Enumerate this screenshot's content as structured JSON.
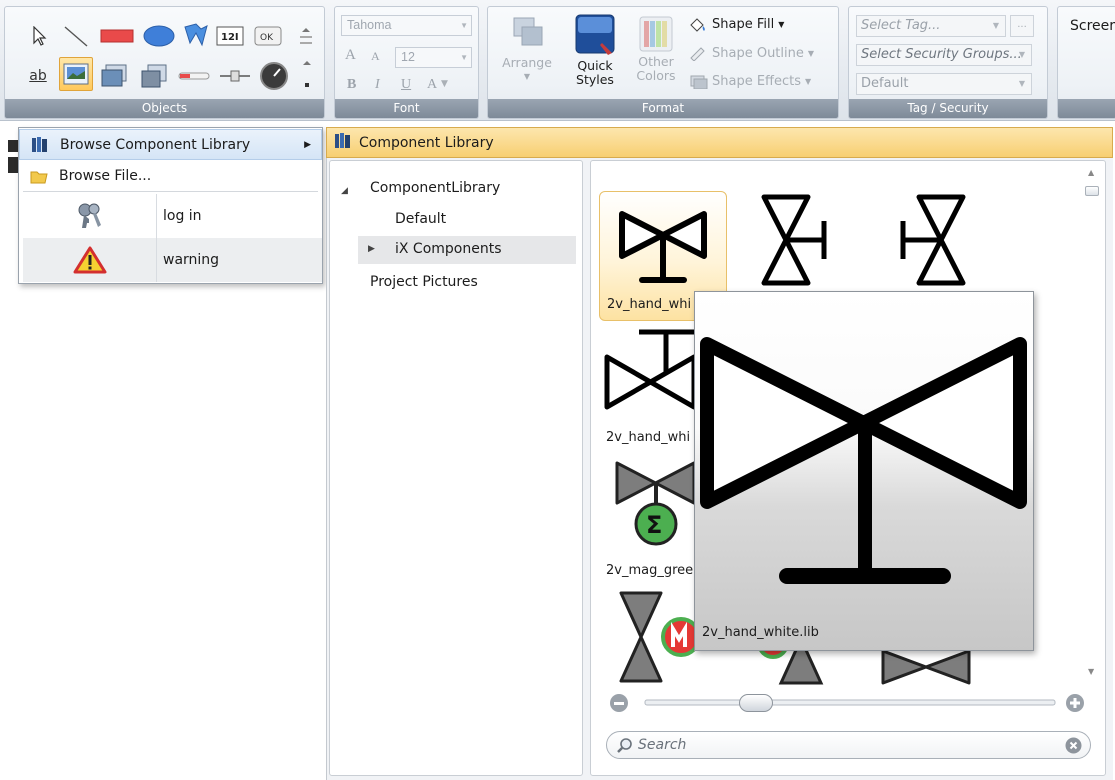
{
  "ribbon": {
    "groups": {
      "objects": "Objects",
      "font": "Font",
      "format": "Format",
      "tag_security": "Tag / Security"
    },
    "object_icons_row1": [
      "pointer-icon",
      "line-icon",
      "rectangle-icon",
      "ellipse-icon",
      "polyline-icon",
      "analog-numeric-icon",
      "button-ok-icon",
      "scroll-up-icon"
    ],
    "object_icons_row2": [
      "text-icon",
      "picture-icon",
      "multi-picture-icon",
      "animated-picture-icon",
      "linear-meter-icon",
      "slider-icon",
      "circular-meter-icon",
      "more-icon"
    ],
    "numeric_label": "12I",
    "ok_label": "OK",
    "text_tool_label": "ab",
    "font": {
      "family": "Tahoma",
      "size": "12",
      "grow": "A",
      "shrink": "A",
      "bold": "B",
      "italic": "I",
      "underline": "U",
      "color": "A"
    },
    "format": {
      "arrange": "Arrange",
      "quick_styles_1": "Quick",
      "quick_styles_2": "Styles",
      "other_colors_1": "Other",
      "other_colors_2": "Colors",
      "shape_fill": "Shape Fill",
      "shape_outline": "Shape Outline",
      "shape_effects": "Shape Effects"
    },
    "tag": {
      "select_tag": "Select Tag...",
      "select_security": "Select Security Groups...",
      "default": "Default",
      "ellipsis": "..."
    },
    "screen_label": "Screer"
  },
  "menu": {
    "browse_library": "Browse Component Library",
    "browse_file": "Browse File...",
    "recent": [
      {
        "label": "log in",
        "icon": "keys-icon"
      },
      {
        "label": "warning",
        "icon": "warning-icon"
      }
    ]
  },
  "library": {
    "header": "Component Library",
    "tree": {
      "root": "ComponentLibrary",
      "default": "Default",
      "ix": "iX Components",
      "project": "Project Pictures"
    },
    "tiles": [
      {
        "label": "2v_hand_whi"
      },
      {
        "label": "2v_hand_whi"
      },
      {
        "label": "2v_mag_gree"
      }
    ],
    "zoom_level": 0.27,
    "search_placeholder": "Search",
    "preview_label": "2v_hand_white.lib"
  },
  "colors": {
    "accent_orange": "#f7cf72",
    "valve_green": "#4caf50",
    "valve_red": "#e53935",
    "valve_gray": "#7d7d7d"
  }
}
